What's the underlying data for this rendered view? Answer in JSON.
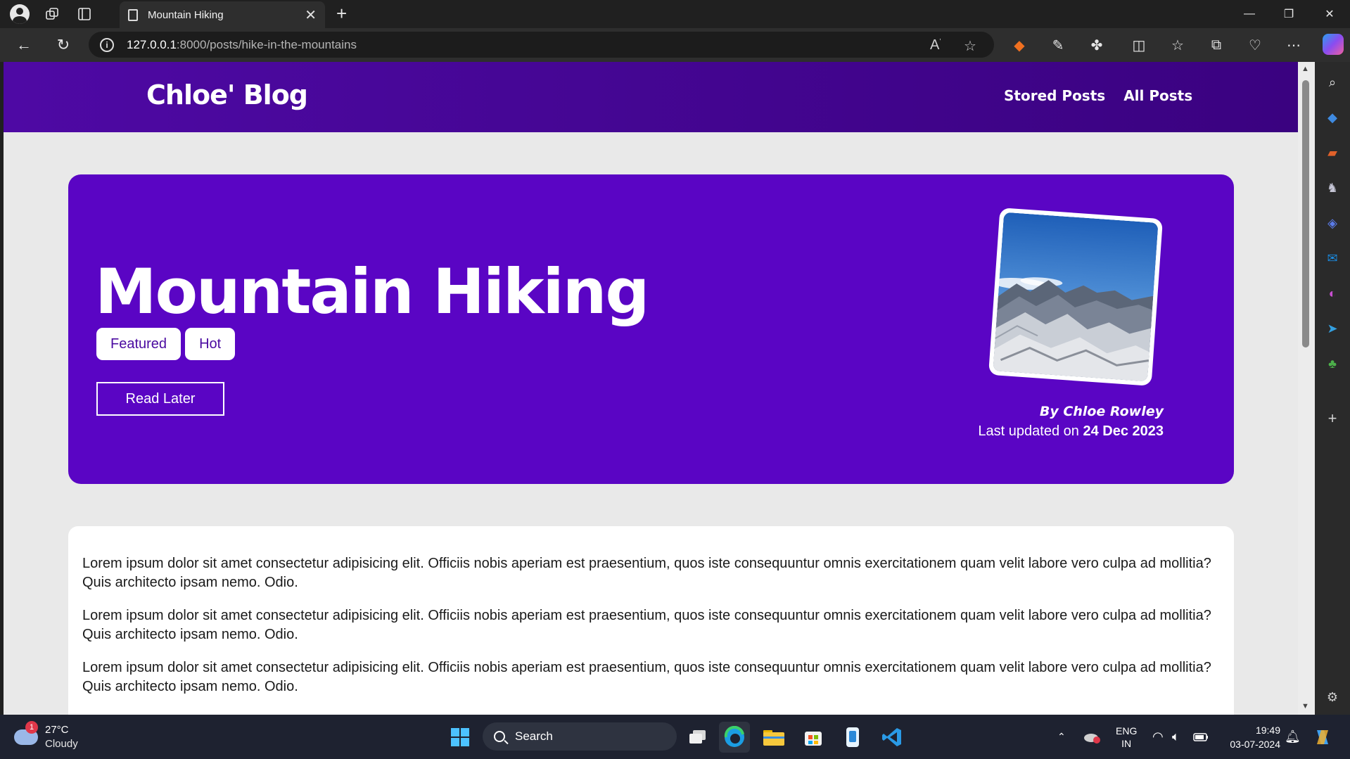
{
  "browser": {
    "tab_title": "Mountain Hiking",
    "url_host": "127.0.0.1",
    "url_rest": ":8000/posts/hike-in-the-mountains"
  },
  "site": {
    "brand": "Chloe' Blog",
    "nav": [
      "Stored Posts",
      "All Posts"
    ]
  },
  "post": {
    "title": "Mountain Hiking",
    "tags": [
      "Featured",
      "Hot"
    ],
    "read_later_label": "Read Later",
    "author": "By Chloe Rowley",
    "updated_prefix": "Last updated on",
    "updated_date": "24 Dec 2023",
    "paragraphs": [
      "Lorem ipsum dolor sit amet consectetur adipisicing elit. Officiis nobis aperiam est praesentium, quos iste consequuntur omnis exercitationem quam velit labore vero culpa ad mollitia? Quis architecto ipsam nemo. Odio.",
      "Lorem ipsum dolor sit amet consectetur adipisicing elit. Officiis nobis aperiam est praesentium, quos iste consequuntur omnis exercitationem quam velit labore vero culpa ad mollitia? Quis architecto ipsam nemo. Odio.",
      "Lorem ipsum dolor sit amet consectetur adipisicing elit. Officiis nobis aperiam est praesentium, quos iste consequuntur omnis exercitationem quam velit labore vero culpa ad mollitia? Quis architecto ipsam nemo. Odio."
    ]
  },
  "taskbar": {
    "weather_temp": "27°C",
    "weather_desc": "Cloudy",
    "weather_badge": "1",
    "search_label": "Search",
    "lang_top": "ENG",
    "lang_bottom": "IN",
    "time": "19:49",
    "date": "03-07-2024"
  },
  "colors": {
    "header": "#4e09a4",
    "hero": "#5a05c4",
    "page_bg": "#e9e9e9"
  }
}
